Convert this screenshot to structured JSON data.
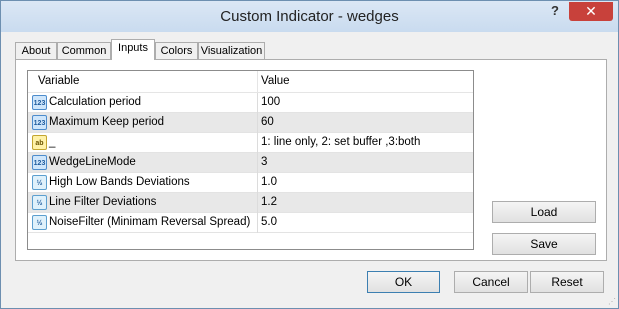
{
  "window": {
    "title": "Custom Indicator - wedges",
    "help": "?",
    "close": "✕"
  },
  "tabs": [
    {
      "label": "About"
    },
    {
      "label": "Common"
    },
    {
      "label": "Inputs"
    },
    {
      "label": "Colors"
    },
    {
      "label": "Visualization"
    }
  ],
  "active_tab": "Inputs",
  "grid": {
    "col_variable": "Variable",
    "col_value": "Value",
    "rows": [
      {
        "type_icon": "int-icon",
        "icon_text": "123",
        "name": "Calculation period",
        "value": "100"
      },
      {
        "type_icon": "int-icon",
        "icon_text": "123",
        "name": "Maximum Keep period",
        "value": "60"
      },
      {
        "type_icon": "string-icon",
        "icon_text": "ab",
        "name": "_",
        "value": "1: line only, 2: set buffer ,3:both"
      },
      {
        "type_icon": "int-icon",
        "icon_text": "123",
        "name": "WedgeLineMode",
        "value": "3"
      },
      {
        "type_icon": "double-icon",
        "icon_text": "½",
        "name": "High Low Bands Deviations",
        "value": "1.0"
      },
      {
        "type_icon": "double-icon",
        "icon_text": "½",
        "name": "Line Filter Deviations",
        "value": "1.2"
      },
      {
        "type_icon": "double-icon",
        "icon_text": "½",
        "name": "NoiseFilter (Minimam Reversal Spread)",
        "value": "5.0"
      }
    ]
  },
  "side_buttons": {
    "load": "Load",
    "save": "Save"
  },
  "footer": {
    "ok": "OK",
    "cancel": "Cancel",
    "reset": "Reset"
  }
}
